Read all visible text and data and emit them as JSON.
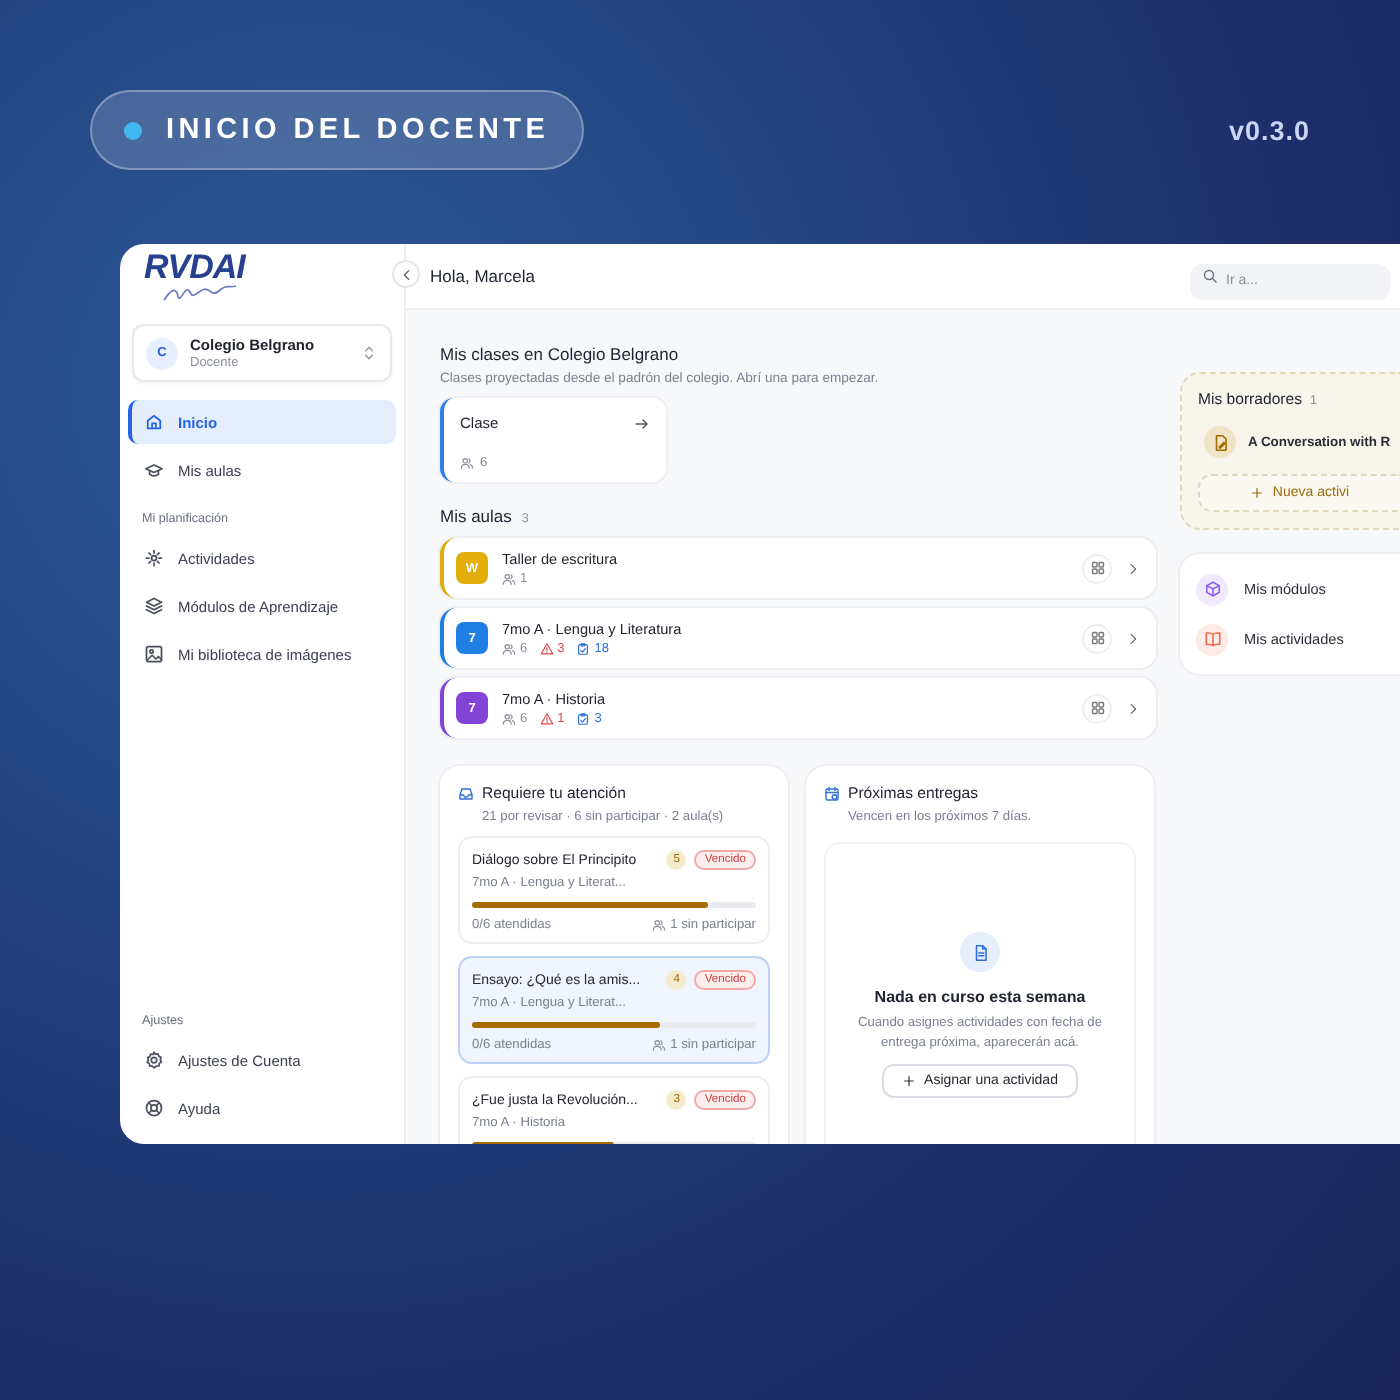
{
  "banner": {
    "label": "INICIO DEL DOCENTE",
    "version": "v0.3.0"
  },
  "logo": {
    "text": "RVDAI"
  },
  "sidebar": {
    "school": {
      "initial": "C",
      "name": "Colegio Belgrano",
      "role": "Docente"
    },
    "nav": [
      {
        "label": "Inicio",
        "selected": true
      },
      {
        "label": "Mis aulas",
        "selected": false
      }
    ],
    "planning": {
      "heading": "Mi planificación",
      "items": [
        {
          "label": "Actividades",
          "selected": false
        },
        {
          "label": "Módulos de Aprendizaje",
          "selected": false
        },
        {
          "label": "Mi biblioteca de imágenes",
          "selected": false
        }
      ]
    },
    "settings": {
      "heading": "Ajustes",
      "items": [
        {
          "label": "Ajustes de Cuenta",
          "selected": false
        },
        {
          "label": "Ayuda",
          "selected": false
        }
      ]
    }
  },
  "topbar": {
    "greeting": "Hola, Marcela",
    "search_placeholder": "Ir a..."
  },
  "classes": {
    "title": "Mis clases en Colegio Belgrano",
    "subtitle": "Clases proyectadas desde el padrón del colegio. Abrí una para empezar.",
    "cards": [
      {
        "name": "Clase",
        "students": "6"
      }
    ]
  },
  "aulas": {
    "title": "Mis aulas",
    "count": "3",
    "rows": [
      {
        "initial": "W",
        "name": "Taller de escritura",
        "color": "#e3ae0b",
        "students": "1"
      },
      {
        "initial": "7",
        "name": "7mo A · Lengua y Literatura",
        "color": "#1f7fe3",
        "students": "6",
        "alerts": "3",
        "tasks": "18"
      },
      {
        "initial": "7",
        "name": "7mo A · Historia",
        "color": "#8344d6",
        "students": "6",
        "alerts": "1",
        "tasks": "3"
      }
    ]
  },
  "attention": {
    "title": "Requiere tu atención",
    "summary": "21 por revisar · 6 sin participar · 2 aula(s)",
    "items": [
      {
        "title": "Diálogo sobre El Principito",
        "count": "5",
        "status": "Vencido",
        "course": "7mo A · Lengua y Literat...",
        "level": 0.83,
        "attended": "0/6 atendidas",
        "missing": "1 sin participar",
        "selected": false
      },
      {
        "title": "Ensayo: ¿Qué es la amis...",
        "count": "4",
        "status": "Vencido",
        "course": "7mo A · Lengua y Literat...",
        "level": 0.66,
        "attended": "0/6 atendidas",
        "missing": "1 sin participar",
        "selected": true
      },
      {
        "title": "¿Fue justa la Revolución...",
        "count": "3",
        "status": "Vencido",
        "course": "7mo A · Historia",
        "level": 0.5,
        "selected": false
      }
    ]
  },
  "deliveries": {
    "title": "Próximas entregas",
    "subtitle": "Vencen en los próximos 7 días.",
    "empty_title": "Nada en curso esta semana",
    "empty_text": "Cuando asignes actividades con fecha de entrega próxima, aparecerán acá.",
    "button": "Asignar una actividad"
  },
  "drafts": {
    "title": "Mis borradores",
    "count": "1",
    "items": [
      {
        "name": "A Conversation with R"
      }
    ],
    "button": "Nueva activi"
  },
  "links": [
    {
      "label": "Mis módulos",
      "color": "#8b5cf6"
    },
    {
      "label": "Mis actividades",
      "color": "#ef6a4c"
    }
  ]
}
